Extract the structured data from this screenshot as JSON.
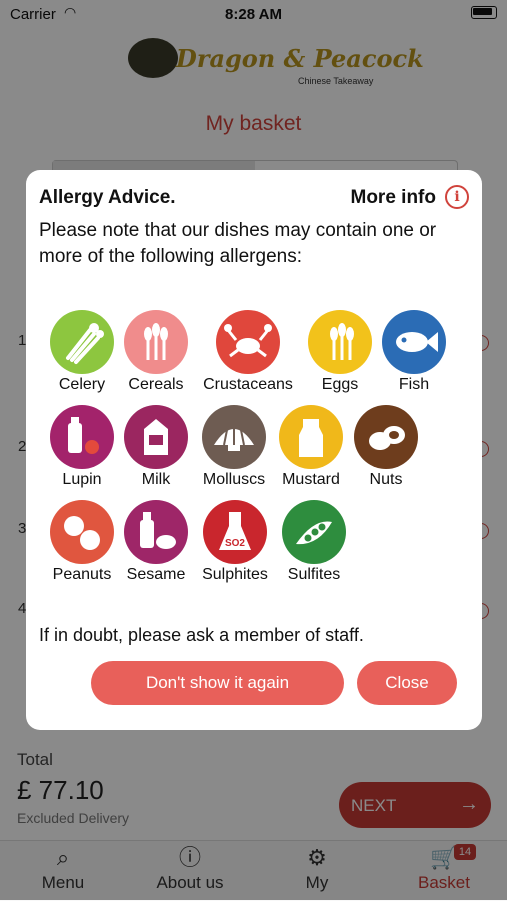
{
  "status": {
    "carrier": "Carrier",
    "time": "8:28 AM"
  },
  "header": {
    "brand": "Dragon & Peacock",
    "brand_sub": "Chinese Takeaway",
    "page_title": "My basket"
  },
  "basket_rows": [
    "1",
    "2",
    "3",
    "4"
  ],
  "footer": {
    "total_label": "Total",
    "total_amount": "£ 77.10",
    "total_note": "Excluded Delivery",
    "next_label": "NEXT",
    "next_arrow": "→"
  },
  "tabs": [
    {
      "label": "Menu",
      "icon": "search-icon"
    },
    {
      "label": "About us",
      "icon": "info-icon"
    },
    {
      "label": "My",
      "icon": "gear-icon"
    },
    {
      "label": "Basket",
      "icon": "cart-icon",
      "badge": "14",
      "active": true
    }
  ],
  "modal": {
    "title": "Allergy Advice.",
    "more_info": "More info",
    "info_glyph": "i",
    "description": "Please note that our dishes may contain one or more of the following allergens:",
    "doubt": "If in doubt, please ask a member of staff.",
    "dont_show": "Don't show it again",
    "close": "Close",
    "allergens": [
      {
        "name": "Celery",
        "color": "#8dc63f"
      },
      {
        "name": "Cereals",
        "color": "#f08c8c"
      },
      {
        "name": "Crustaceans",
        "color": "#e0473c"
      },
      {
        "name": "Eggs",
        "color": "#f2c21b"
      },
      {
        "name": "Fish",
        "color": "#2b6cb5"
      },
      {
        "name": "Lupin",
        "color": "#a3236b"
      },
      {
        "name": "Milk",
        "color": "#9b2660"
      },
      {
        "name": "Molluscs",
        "color": "#6e5c52"
      },
      {
        "name": "Mustard",
        "color": "#f0b81a"
      },
      {
        "name": "Nuts",
        "color": "#6e3d1d"
      },
      {
        "name": "Peanuts",
        "color": "#e0563f"
      },
      {
        "name": "Sesame",
        "color": "#9e2668"
      },
      {
        "name": "Sulphites",
        "color": "#c9262d",
        "so2": "SO2"
      },
      {
        "name": "Sulfites",
        "color": "#2e8d3e"
      }
    ]
  }
}
